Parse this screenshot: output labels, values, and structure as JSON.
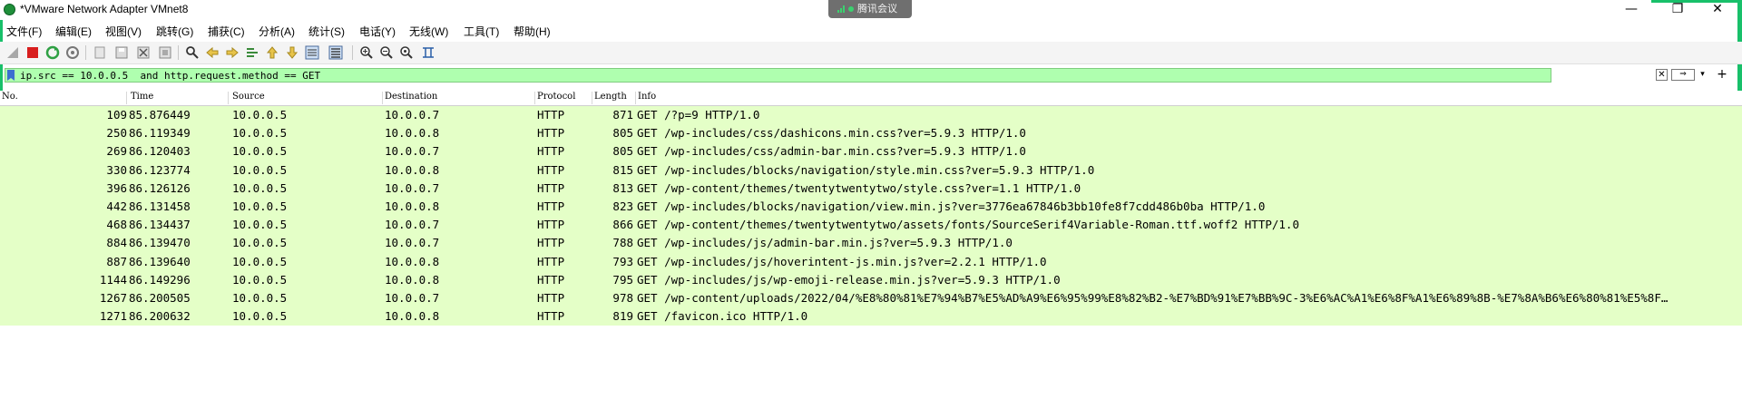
{
  "window": {
    "title": "*VMware Network Adapter VMnet8"
  },
  "meeting_badge": {
    "label": "腾讯会议"
  },
  "window_controls": {
    "minimize": "—",
    "maximize": "❐",
    "close": "✕"
  },
  "menu": [
    {
      "label": "文件(F)"
    },
    {
      "label": "编辑(E)"
    },
    {
      "label": "视图(V)"
    },
    {
      "label": "跳转(G)"
    },
    {
      "label": "捕获(C)"
    },
    {
      "label": "分析(A)"
    },
    {
      "label": "统计(S)"
    },
    {
      "label": "电话(Y)"
    },
    {
      "label": "无线(W)"
    },
    {
      "label": "工具(T)"
    },
    {
      "label": "帮助(H)"
    }
  ],
  "toolbar": [
    {
      "icon": "start-capture-icon"
    },
    {
      "icon": "stop-capture-icon"
    },
    {
      "icon": "restart-capture-icon"
    },
    {
      "icon": "capture-options-icon"
    },
    {
      "icon": "open-file-icon"
    },
    {
      "icon": "save-file-icon"
    },
    {
      "icon": "close-file-icon"
    },
    {
      "icon": "reload-icon"
    },
    {
      "icon": "find-packet-icon"
    },
    {
      "icon": "go-back-icon"
    },
    {
      "icon": "go-forward-icon"
    },
    {
      "icon": "go-to-packet-icon"
    },
    {
      "icon": "first-packet-icon"
    },
    {
      "icon": "last-packet-icon"
    },
    {
      "icon": "autoscroll-icon"
    },
    {
      "icon": "colorize-icon"
    },
    {
      "icon": "zoom-in-icon"
    },
    {
      "icon": "zoom-out-icon"
    },
    {
      "icon": "normal-size-icon"
    },
    {
      "icon": "resize-columns-icon"
    }
  ],
  "filter": {
    "value": "ip.src == 10.0.0.5  and http.request.method == GET",
    "background": "#afffaf",
    "clear_symbol": "✕",
    "apply_symbol": "⇒",
    "dropdown_symbol": "▾",
    "add_symbol": "+"
  },
  "columns": {
    "no": "No.",
    "time": "Time",
    "source": "Source",
    "destination": "Destination",
    "protocol": "Protocol",
    "length": "Length",
    "info": "Info"
  },
  "row_color": "#e4ffc7",
  "packets": [
    {
      "no": "109",
      "time": "85.876449",
      "src": "10.0.0.5",
      "dst": "10.0.0.7",
      "proto": "HTTP",
      "len": "871",
      "info": "GET /?p=9 HTTP/1.0"
    },
    {
      "no": "250",
      "time": "86.119349",
      "src": "10.0.0.5",
      "dst": "10.0.0.8",
      "proto": "HTTP",
      "len": "805",
      "info": "GET /wp-includes/css/dashicons.min.css?ver=5.9.3 HTTP/1.0"
    },
    {
      "no": "269",
      "time": "86.120403",
      "src": "10.0.0.5",
      "dst": "10.0.0.7",
      "proto": "HTTP",
      "len": "805",
      "info": "GET /wp-includes/css/admin-bar.min.css?ver=5.9.3 HTTP/1.0"
    },
    {
      "no": "330",
      "time": "86.123774",
      "src": "10.0.0.5",
      "dst": "10.0.0.8",
      "proto": "HTTP",
      "len": "815",
      "info": "GET /wp-includes/blocks/navigation/style.min.css?ver=5.9.3 HTTP/1.0"
    },
    {
      "no": "396",
      "time": "86.126126",
      "src": "10.0.0.5",
      "dst": "10.0.0.7",
      "proto": "HTTP",
      "len": "813",
      "info": "GET /wp-content/themes/twentytwentytwo/style.css?ver=1.1 HTTP/1.0"
    },
    {
      "no": "442",
      "time": "86.131458",
      "src": "10.0.0.5",
      "dst": "10.0.0.8",
      "proto": "HTTP",
      "len": "823",
      "info": "GET /wp-includes/blocks/navigation/view.min.js?ver=3776ea67846b3bb10fe8f7cdd486b0ba HTTP/1.0"
    },
    {
      "no": "468",
      "time": "86.134437",
      "src": "10.0.0.5",
      "dst": "10.0.0.7",
      "proto": "HTTP",
      "len": "866",
      "info": "GET /wp-content/themes/twentytwentytwo/assets/fonts/SourceSerif4Variable-Roman.ttf.woff2 HTTP/1.0"
    },
    {
      "no": "884",
      "time": "86.139470",
      "src": "10.0.0.5",
      "dst": "10.0.0.7",
      "proto": "HTTP",
      "len": "788",
      "info": "GET /wp-includes/js/admin-bar.min.js?ver=5.9.3 HTTP/1.0"
    },
    {
      "no": "887",
      "time": "86.139640",
      "src": "10.0.0.5",
      "dst": "10.0.0.8",
      "proto": "HTTP",
      "len": "793",
      "info": "GET /wp-includes/js/hoverintent-js.min.js?ver=2.2.1 HTTP/1.0"
    },
    {
      "no": "1144",
      "time": "86.149296",
      "src": "10.0.0.5",
      "dst": "10.0.0.8",
      "proto": "HTTP",
      "len": "795",
      "info": "GET /wp-includes/js/wp-emoji-release.min.js?ver=5.9.3 HTTP/1.0"
    },
    {
      "no": "1267",
      "time": "86.200505",
      "src": "10.0.0.5",
      "dst": "10.0.0.7",
      "proto": "HTTP",
      "len": "978",
      "info": "GET /wp-content/uploads/2022/04/%E8%80%81%E7%94%B7%E5%AD%A9%E6%95%99%E8%82%B2-%E7%BD%91%E7%BB%9C-3%E6%AC%A1%E6%8F%A1%E6%89%8B-%E7%8A%B6%E6%80%81%E5%8F…"
    },
    {
      "no": "1271",
      "time": "86.200632",
      "src": "10.0.0.5",
      "dst": "10.0.0.8",
      "proto": "HTTP",
      "len": "819",
      "info": "GET /favicon.ico HTTP/1.0"
    }
  ]
}
